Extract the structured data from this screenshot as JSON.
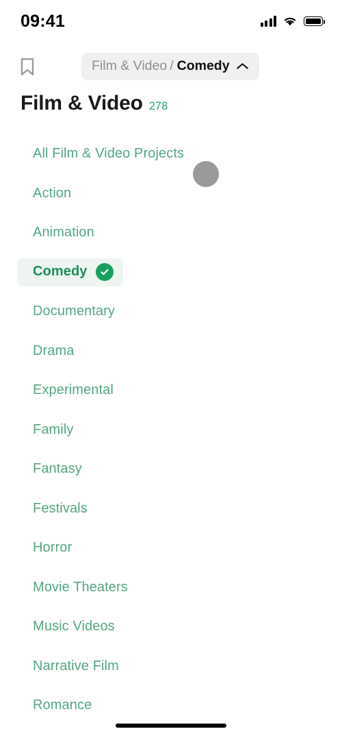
{
  "status_bar": {
    "time": "09:41",
    "signal_icon": "cellular-signal-icon",
    "wifi_icon": "wifi-icon",
    "battery_icon": "battery-full-icon"
  },
  "nav": {
    "bookmark_icon": "bookmark-icon",
    "breadcrumb": {
      "parent": "Film & Video",
      "separator": "/",
      "current": "Comedy",
      "chevron_icon": "chevron-up-icon"
    }
  },
  "header": {
    "title": "Film & Video",
    "count": "278"
  },
  "categories": {
    "selected": "Comedy",
    "check_icon": "check-circle-icon",
    "items": [
      {
        "label": "All Film & Video Projects",
        "selected": false
      },
      {
        "label": "Action",
        "selected": false
      },
      {
        "label": "Animation",
        "selected": false
      },
      {
        "label": "Comedy",
        "selected": true
      },
      {
        "label": "Documentary",
        "selected": false
      },
      {
        "label": "Drama",
        "selected": false
      },
      {
        "label": "Experimental",
        "selected": false
      },
      {
        "label": "Family",
        "selected": false
      },
      {
        "label": "Fantasy",
        "selected": false
      },
      {
        "label": "Festivals",
        "selected": false
      },
      {
        "label": "Horror",
        "selected": false
      },
      {
        "label": "Movie Theaters",
        "selected": false
      },
      {
        "label": "Music Videos",
        "selected": false
      },
      {
        "label": "Narrative Film",
        "selected": false
      },
      {
        "label": "Romance",
        "selected": false
      }
    ]
  },
  "cursor": {
    "name": "touch-cursor-indicator"
  },
  "home_indicator": {
    "name": "home-indicator"
  },
  "colors": {
    "accent_green": "#54a683",
    "selected_green": "#1f8d5a",
    "check_green": "#17a05c",
    "count_green": "#2e9e6b",
    "pill_bg": "#f0f0f0",
    "selected_pill_bg": "#eef5f1"
  }
}
